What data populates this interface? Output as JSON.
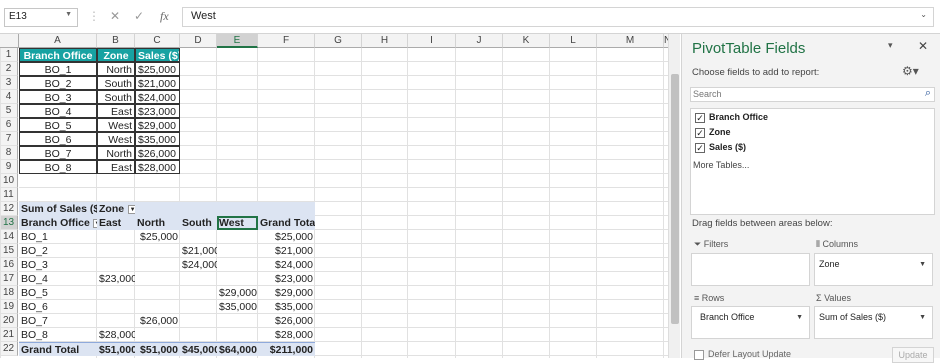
{
  "formula_bar": {
    "name_box": "E13",
    "fx": "fx",
    "value": "West"
  },
  "columns": [
    "A",
    "B",
    "C",
    "D",
    "E",
    "F",
    "G",
    "H",
    "I",
    "J",
    "K",
    "L",
    "M",
    "N"
  ],
  "rows": [
    "1",
    "2",
    "3",
    "4",
    "5",
    "6",
    "7",
    "8",
    "9",
    "10",
    "11",
    "12",
    "13",
    "14",
    "15",
    "16",
    "17",
    "18",
    "19",
    "20",
    "21",
    "22"
  ],
  "source_table": {
    "headers": [
      "Branch Office",
      "Zone",
      "Sales ($)"
    ],
    "rows": [
      [
        "BO_1",
        "North",
        "$25,000"
      ],
      [
        "BO_2",
        "South",
        "$21,000"
      ],
      [
        "BO_3",
        "South",
        "$24,000"
      ],
      [
        "BO_4",
        "East",
        "$23,000"
      ],
      [
        "BO_5",
        "West",
        "$29,000"
      ],
      [
        "BO_6",
        "West",
        "$35,000"
      ],
      [
        "BO_7",
        "North",
        "$26,000"
      ],
      [
        "BO_8",
        "East",
        "$28,000"
      ]
    ]
  },
  "pivot": {
    "values_label": "Sum of Sales ($)",
    "col_field": "Zone",
    "row_field": "Branch Office",
    "col_headers": [
      "East",
      "North",
      "South",
      "West",
      "Grand Total"
    ],
    "rows": [
      {
        "label": "BO_1",
        "values": [
          "",
          "$25,000",
          "",
          "",
          "$25,000"
        ]
      },
      {
        "label": "BO_2",
        "values": [
          "",
          "",
          "$21,000",
          "",
          "$21,000"
        ]
      },
      {
        "label": "BO_3",
        "values": [
          "",
          "",
          "$24,000",
          "",
          "$24,000"
        ]
      },
      {
        "label": "BO_4",
        "values": [
          "$23,000",
          "",
          "",
          "",
          "$23,000"
        ]
      },
      {
        "label": "BO_5",
        "values": [
          "",
          "",
          "",
          "$29,000",
          "$29,000"
        ]
      },
      {
        "label": "BO_6",
        "values": [
          "",
          "",
          "",
          "$35,000",
          "$35,000"
        ]
      },
      {
        "label": "BO_7",
        "values": [
          "",
          "$26,000",
          "",
          "",
          "$26,000"
        ]
      },
      {
        "label": "BO_8",
        "values": [
          "$28,000",
          "",
          "",
          "",
          "$28,000"
        ]
      }
    ],
    "grand_total": {
      "label": "Grand Total",
      "values": [
        "$51,000",
        "$51,000",
        "$45,000",
        "$64,000",
        "$211,000"
      ]
    }
  },
  "panel": {
    "title": "PivotTable Fields",
    "subtitle": "Choose fields to add to report:",
    "search_placeholder": "Search",
    "fields": [
      {
        "label": "Branch Office",
        "checked": true
      },
      {
        "label": "Zone",
        "checked": true
      },
      {
        "label": "Sales ($)",
        "checked": true
      }
    ],
    "more_tables": "More Tables...",
    "drag_label": "Drag fields between areas below:",
    "filters_label": "Filters",
    "columns_label": "Columns",
    "columns_item": "Zone",
    "rows_label": "Rows",
    "rows_item": "Branch Office",
    "values_label": "Values",
    "values_item": "Sum of Sales ($)",
    "defer_label": "Defer Layout Update",
    "update_label": "Update"
  },
  "colors": {
    "table_header": "#17a2a2",
    "pivot_header": "#dce4f2",
    "panel_bg": "#f3f3f3"
  }
}
